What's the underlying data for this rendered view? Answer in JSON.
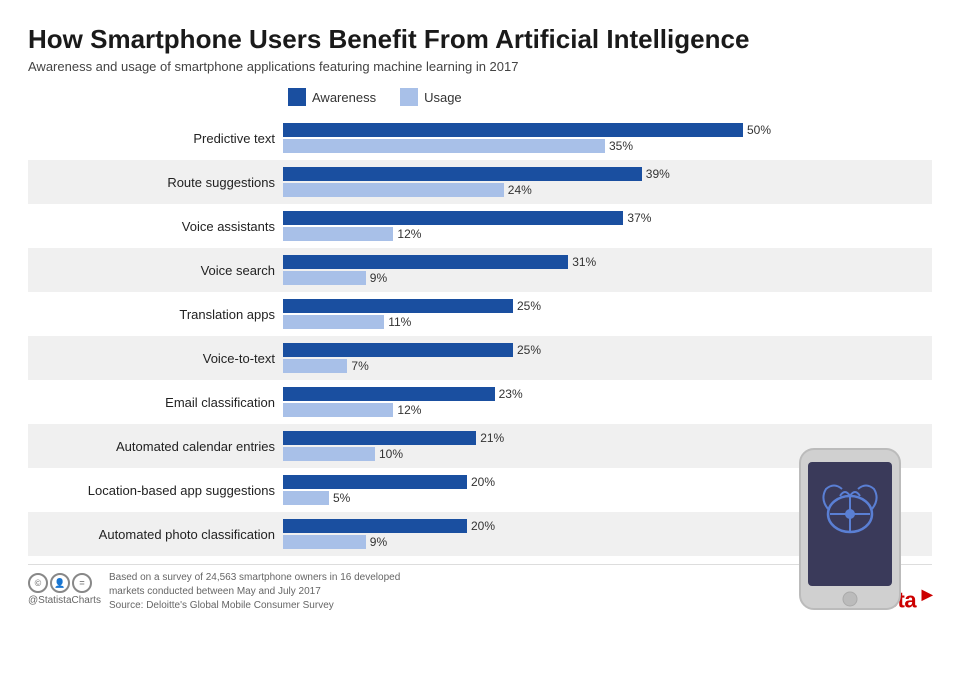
{
  "title": "How Smartphone Users Benefit From Artificial Intelligence",
  "subtitle": "Awareness and usage of smartphone applications featuring machine learning in 2017",
  "legend": {
    "awareness_label": "Awareness",
    "usage_label": "Usage",
    "awareness_color": "#1a4fa0",
    "usage_color": "#a8c0e8"
  },
  "bars": [
    {
      "label": "Predictive text",
      "awareness": 50,
      "usage": 35,
      "shaded": false
    },
    {
      "label": "Route suggestions",
      "awareness": 39,
      "usage": 24,
      "shaded": true
    },
    {
      "label": "Voice assistants",
      "awareness": 37,
      "usage": 12,
      "shaded": false
    },
    {
      "label": "Voice search",
      "awareness": 31,
      "usage": 9,
      "shaded": true
    },
    {
      "label": "Translation apps",
      "awareness": 25,
      "usage": 11,
      "shaded": false
    },
    {
      "label": "Voice-to-text",
      "awareness": 25,
      "usage": 7,
      "shaded": true
    },
    {
      "label": "Email classification",
      "awareness": 23,
      "usage": 12,
      "shaded": false
    },
    {
      "label": "Automated calendar entries",
      "awareness": 21,
      "usage": 10,
      "shaded": true
    },
    {
      "label": "Location-based app suggestions",
      "awareness": 20,
      "usage": 5,
      "shaded": false
    },
    {
      "label": "Automated photo classification",
      "awareness": 20,
      "usage": 9,
      "shaded": true
    }
  ],
  "max_bar_width": 580,
  "max_value": 50,
  "footer": {
    "source_text": "Based on a survey of 24,563 smartphone owners in 16 developed\nmarkets conducted between May and July 2017\nSource: Deloitte's Global Mobile Consumer Survey",
    "brand": "statista",
    "cc_label": "@StatistaCharts"
  }
}
